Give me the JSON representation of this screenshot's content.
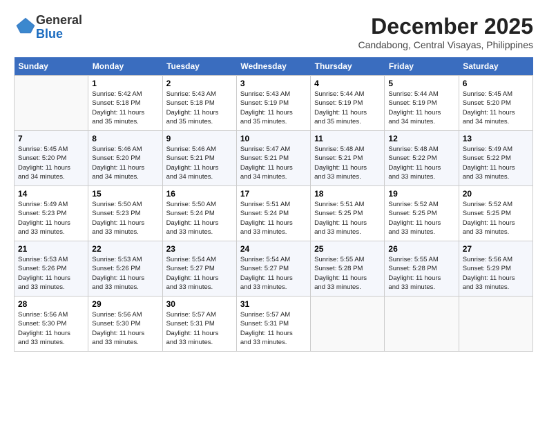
{
  "logo": {
    "general": "General",
    "blue": "Blue"
  },
  "header": {
    "month": "December 2025",
    "location": "Candabong, Central Visayas, Philippines"
  },
  "weekdays": [
    "Sunday",
    "Monday",
    "Tuesday",
    "Wednesday",
    "Thursday",
    "Friday",
    "Saturday"
  ],
  "weeks": [
    [
      {
        "day": "",
        "info": ""
      },
      {
        "day": "1",
        "info": "Sunrise: 5:42 AM\nSunset: 5:18 PM\nDaylight: 11 hours\nand 35 minutes."
      },
      {
        "day": "2",
        "info": "Sunrise: 5:43 AM\nSunset: 5:18 PM\nDaylight: 11 hours\nand 35 minutes."
      },
      {
        "day": "3",
        "info": "Sunrise: 5:43 AM\nSunset: 5:19 PM\nDaylight: 11 hours\nand 35 minutes."
      },
      {
        "day": "4",
        "info": "Sunrise: 5:44 AM\nSunset: 5:19 PM\nDaylight: 11 hours\nand 35 minutes."
      },
      {
        "day": "5",
        "info": "Sunrise: 5:44 AM\nSunset: 5:19 PM\nDaylight: 11 hours\nand 34 minutes."
      },
      {
        "day": "6",
        "info": "Sunrise: 5:45 AM\nSunset: 5:20 PM\nDaylight: 11 hours\nand 34 minutes."
      }
    ],
    [
      {
        "day": "7",
        "info": "Sunrise: 5:45 AM\nSunset: 5:20 PM\nDaylight: 11 hours\nand 34 minutes."
      },
      {
        "day": "8",
        "info": "Sunrise: 5:46 AM\nSunset: 5:20 PM\nDaylight: 11 hours\nand 34 minutes."
      },
      {
        "day": "9",
        "info": "Sunrise: 5:46 AM\nSunset: 5:21 PM\nDaylight: 11 hours\nand 34 minutes."
      },
      {
        "day": "10",
        "info": "Sunrise: 5:47 AM\nSunset: 5:21 PM\nDaylight: 11 hours\nand 34 minutes."
      },
      {
        "day": "11",
        "info": "Sunrise: 5:48 AM\nSunset: 5:21 PM\nDaylight: 11 hours\nand 33 minutes."
      },
      {
        "day": "12",
        "info": "Sunrise: 5:48 AM\nSunset: 5:22 PM\nDaylight: 11 hours\nand 33 minutes."
      },
      {
        "day": "13",
        "info": "Sunrise: 5:49 AM\nSunset: 5:22 PM\nDaylight: 11 hours\nand 33 minutes."
      }
    ],
    [
      {
        "day": "14",
        "info": "Sunrise: 5:49 AM\nSunset: 5:23 PM\nDaylight: 11 hours\nand 33 minutes."
      },
      {
        "day": "15",
        "info": "Sunrise: 5:50 AM\nSunset: 5:23 PM\nDaylight: 11 hours\nand 33 minutes."
      },
      {
        "day": "16",
        "info": "Sunrise: 5:50 AM\nSunset: 5:24 PM\nDaylight: 11 hours\nand 33 minutes."
      },
      {
        "day": "17",
        "info": "Sunrise: 5:51 AM\nSunset: 5:24 PM\nDaylight: 11 hours\nand 33 minutes."
      },
      {
        "day": "18",
        "info": "Sunrise: 5:51 AM\nSunset: 5:25 PM\nDaylight: 11 hours\nand 33 minutes."
      },
      {
        "day": "19",
        "info": "Sunrise: 5:52 AM\nSunset: 5:25 PM\nDaylight: 11 hours\nand 33 minutes."
      },
      {
        "day": "20",
        "info": "Sunrise: 5:52 AM\nSunset: 5:25 PM\nDaylight: 11 hours\nand 33 minutes."
      }
    ],
    [
      {
        "day": "21",
        "info": "Sunrise: 5:53 AM\nSunset: 5:26 PM\nDaylight: 11 hours\nand 33 minutes."
      },
      {
        "day": "22",
        "info": "Sunrise: 5:53 AM\nSunset: 5:26 PM\nDaylight: 11 hours\nand 33 minutes."
      },
      {
        "day": "23",
        "info": "Sunrise: 5:54 AM\nSunset: 5:27 PM\nDaylight: 11 hours\nand 33 minutes."
      },
      {
        "day": "24",
        "info": "Sunrise: 5:54 AM\nSunset: 5:27 PM\nDaylight: 11 hours\nand 33 minutes."
      },
      {
        "day": "25",
        "info": "Sunrise: 5:55 AM\nSunset: 5:28 PM\nDaylight: 11 hours\nand 33 minutes."
      },
      {
        "day": "26",
        "info": "Sunrise: 5:55 AM\nSunset: 5:28 PM\nDaylight: 11 hours\nand 33 minutes."
      },
      {
        "day": "27",
        "info": "Sunrise: 5:56 AM\nSunset: 5:29 PM\nDaylight: 11 hours\nand 33 minutes."
      }
    ],
    [
      {
        "day": "28",
        "info": "Sunrise: 5:56 AM\nSunset: 5:30 PM\nDaylight: 11 hours\nand 33 minutes."
      },
      {
        "day": "29",
        "info": "Sunrise: 5:56 AM\nSunset: 5:30 PM\nDaylight: 11 hours\nand 33 minutes."
      },
      {
        "day": "30",
        "info": "Sunrise: 5:57 AM\nSunset: 5:31 PM\nDaylight: 11 hours\nand 33 minutes."
      },
      {
        "day": "31",
        "info": "Sunrise: 5:57 AM\nSunset: 5:31 PM\nDaylight: 11 hours\nand 33 minutes."
      },
      {
        "day": "",
        "info": ""
      },
      {
        "day": "",
        "info": ""
      },
      {
        "day": "",
        "info": ""
      }
    ]
  ]
}
